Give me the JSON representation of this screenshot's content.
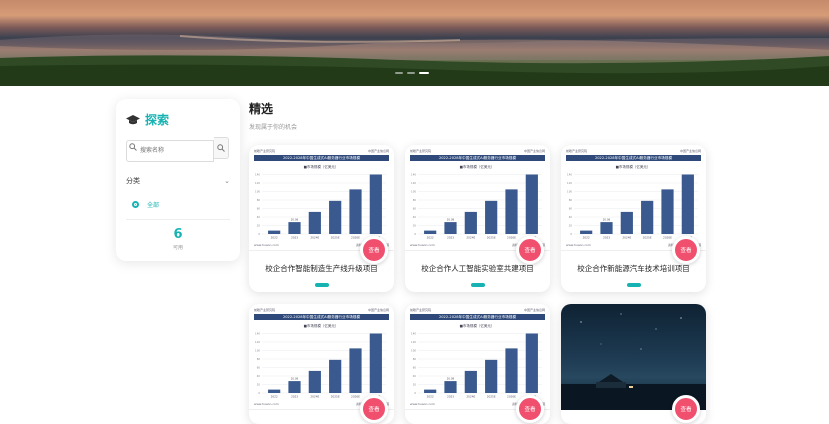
{
  "hero": {
    "slides": 3,
    "active_slide": 3
  },
  "sidebar": {
    "title": "探索",
    "search_placeholder": "搜索名称",
    "category_label": "分类",
    "option_all": "全部",
    "count": "6",
    "count_label": "可用"
  },
  "section": {
    "title": "精选",
    "subtitle": "发现属于你的机会"
  },
  "chart_thumb": {
    "org": "前瞻产业研究院",
    "heading": "2022-2028年中国生成式AI服务器行业市场规模",
    "legend": "■市场规模（亿美元）",
    "categories": [
      "2022",
      "2023",
      "2024E",
      "2025E",
      "2026E",
      "2028E"
    ],
    "values": [
      8,
      28,
      52,
      78,
      105,
      140
    ],
    "value_labels": [
      "",
      "20.08",
      "",
      "",
      "",
      ""
    ],
    "source": "资料来源：公开资料整理",
    "site": "www.huaon.com",
    "top_right": "中国产业信息网"
  },
  "cards": [
    {
      "title": "校企合作智能制造生产线升级项目",
      "button": "查看",
      "thumb": "chart"
    },
    {
      "title": "校企合作人工智能实验室共建项目",
      "button": "查看",
      "thumb": "chart"
    },
    {
      "title": "校企合作新能源汽车技术培训项目",
      "button": "查看",
      "thumb": "chart"
    },
    {
      "title": "",
      "button": "查看",
      "thumb": "chart"
    },
    {
      "title": "",
      "button": "查看",
      "thumb": "chart"
    },
    {
      "title": "",
      "button": "查看",
      "thumb": "night"
    }
  ],
  "colors": {
    "accent": "#17b3b3",
    "button": "#f0506e",
    "bar": "#3a5a8f"
  }
}
